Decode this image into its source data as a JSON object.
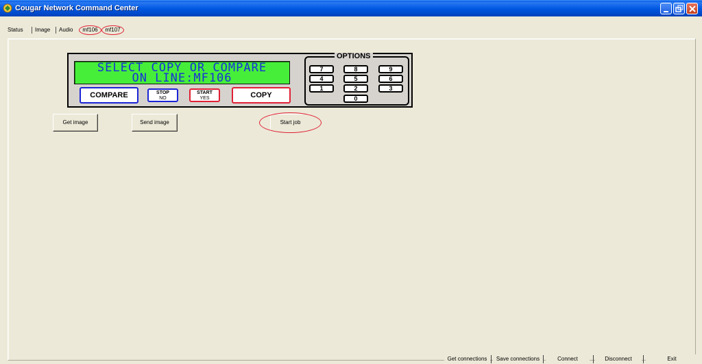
{
  "window": {
    "title": "Cougar Network Command Center"
  },
  "tabs": [
    "Status",
    "Image",
    "Audio",
    "mf106",
    "mf107"
  ],
  "device": {
    "lcd_line1": "SELECT COPY OR COMPARE",
    "lcd_line2": "ON LINE:MF106",
    "compare_label": "COMPARE",
    "stop_label": "STOP",
    "stop_sub": "NO",
    "start_label": "START",
    "start_sub": "YES",
    "copy_label": "COPY",
    "options_label": "OPTIONS",
    "keys": [
      "7",
      "8",
      "9",
      "4",
      "5",
      "6",
      "1",
      "2",
      "3",
      "0"
    ]
  },
  "actions": {
    "get_image": "Get image",
    "send_image": "Send image",
    "start_job": "Start job"
  },
  "bottom_buttons": [
    "Get connections",
    "Save connections",
    "Connect",
    "Disconnect",
    "Exit"
  ],
  "colors": {
    "title_bar": "#0058e2",
    "lcd_bg": "#46ee3a",
    "lcd_text": "#1730d8",
    "highlight": "#e02034"
  }
}
